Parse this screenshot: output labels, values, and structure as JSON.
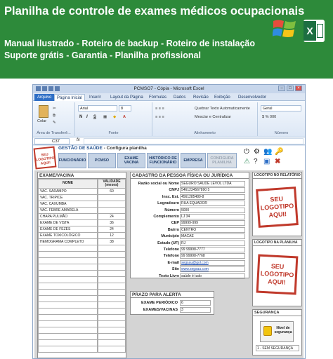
{
  "banner": {
    "title": "Planilha de controle de exames médicos ocupacionais",
    "line1": "Manual ilustrado - Roteiro de backup - Roteiro de instalação",
    "line2": "Suporte grátis - Garantia - Planilha profissional",
    "logos": [
      "windows-logo",
      "excel-logo"
    ]
  },
  "excel": {
    "window_title": "PCMSO7 - Cópia - Microsoft Excel",
    "tabs": [
      "Arquivo",
      "Página Inicial",
      "Inserir",
      "Layout da Página",
      "Fórmulas",
      "Dados",
      "Revisão",
      "Exibição",
      "Desenvolvedor"
    ],
    "active_tab": "Página Inicial",
    "ribbon": {
      "paste": "Colar",
      "font_name": "Arial",
      "font_size": "8",
      "clipboard_label": "Área de Transferê...",
      "font_label": "Fonte",
      "alignment_label": "Alinhamento",
      "number_label": "Número",
      "wrap_text": "Quebrar Texto Automaticamente",
      "merge_center": "Mesclar e Centralizar",
      "number_format": "Geral",
      "bold": "N",
      "italic": "I",
      "underline": "S"
    },
    "name_box": "C37",
    "fx": "fx"
  },
  "app": {
    "logo_text": "SEU LOGOTIPO AQUI!",
    "header_title": "GESTÃO DE SAÚDE",
    "header_sub": "- Configura planilha",
    "nav": [
      {
        "label": "FUNCIONÁRIO",
        "disabled": false
      },
      {
        "label": "PCMSO",
        "disabled": false
      },
      {
        "label": "EXAME VACINA",
        "disabled": false
      },
      {
        "label": "HISTÓRICO DE FUNCIONÁRIO",
        "disabled": false
      },
      {
        "label": "EMPRESA",
        "disabled": false
      },
      {
        "label": "CONFIGURA PLANILHA",
        "disabled": true
      }
    ],
    "exam": {
      "title": "EXAME/VACINA",
      "col_name": "NOME",
      "col_validity": "VALIDADE (meses)",
      "rows": [
        {
          "name": "VAC. SARAMPO",
          "validity": "60"
        },
        {
          "name": "VAC. TRIPICE",
          "validity": ""
        },
        {
          "name": "VAC. CAXUMBA",
          "validity": ""
        },
        {
          "name": "VAC. FEBRE AMARELA",
          "validity": ""
        },
        {
          "name": "CHAPA PULMÃO",
          "validity": "24"
        },
        {
          "name": "EXAME DE VISTA",
          "validity": "36"
        },
        {
          "name": "EXAME DE FEZES",
          "validity": "24"
        },
        {
          "name": "EXAME TOXICOLÓGICO",
          "validity": "12"
        },
        {
          "name": "HEMOGRAMA COMPLETO",
          "validity": "38"
        },
        {
          "name": "",
          "validity": ""
        },
        {
          "name": "",
          "validity": ""
        },
        {
          "name": "",
          "validity": ""
        },
        {
          "name": "",
          "validity": ""
        },
        {
          "name": "",
          "validity": ""
        },
        {
          "name": "",
          "validity": ""
        },
        {
          "name": "",
          "validity": ""
        },
        {
          "name": "",
          "validity": ""
        },
        {
          "name": "",
          "validity": ""
        },
        {
          "name": "",
          "validity": ""
        },
        {
          "name": "",
          "validity": ""
        },
        {
          "name": "",
          "validity": ""
        },
        {
          "name": "",
          "validity": ""
        },
        {
          "name": "",
          "validity": ""
        },
        {
          "name": "",
          "validity": ""
        },
        {
          "name": "",
          "validity": ""
        },
        {
          "name": "",
          "validity": ""
        }
      ]
    },
    "cadastro": {
      "title": "CADASTRO DA PESSOA FÍSICA OU JURÍDICA",
      "fields": [
        {
          "label": "Razão social ou Nome",
          "value": "SEGURO SAÚDE LEVOL LTDA",
          "link": false
        },
        {
          "label": "CNPJ",
          "value": "5461234567890 5",
          "link": false
        },
        {
          "label": "Insc. Est.",
          "value": "4561285489-8",
          "link": false
        },
        {
          "label": "Logradouro",
          "value": "RUA EQUADOR",
          "link": false
        },
        {
          "label": "Número",
          "value": "5000",
          "link": false
        },
        {
          "label": "Complemento",
          "value": "LJ 34",
          "link": false
        },
        {
          "label": "CEP",
          "value": "99999-999",
          "link": false
        },
        {
          "label": "Bairro",
          "value": "CENTRO",
          "link": false
        },
        {
          "label": "Município",
          "value": "MACAÉ",
          "link": false
        },
        {
          "label": "Estado (UF)",
          "value": "RJ",
          "link": false
        },
        {
          "label": "Telefone",
          "value": "99 99998-7777",
          "link": false
        },
        {
          "label": "Telefone",
          "value": "99 99998-7768",
          "link": false
        },
        {
          "label": "E-mail",
          "value": "segsau@gol.com",
          "link": true
        },
        {
          "label": "Site",
          "value": "www.segsau.com",
          "link": true
        },
        {
          "label": "Texto Livre",
          "value": "saúde é tudo",
          "link": false
        }
      ]
    },
    "prazo": {
      "title": "PRAZO PARA ALERTA",
      "fields": [
        {
          "label": "EXAME PERIÓDICO",
          "value": "6"
        },
        {
          "label": "EXAMES/VACINAS",
          "value": "3"
        }
      ]
    },
    "logo_report": {
      "title": "LOGOTIPO NO RELATÓRIO",
      "text": "SEU LOGOTIPO AQUI!"
    },
    "logo_sheet": {
      "title": "LOGOTIPO NA PLANILHA",
      "text": "SEU LOGOTIPO AQUI!"
    },
    "security": {
      "title": "SEGURANÇA",
      "lock_text": "Nível de segurança",
      "value": "1 - SEM SEGURANÇA"
    }
  }
}
